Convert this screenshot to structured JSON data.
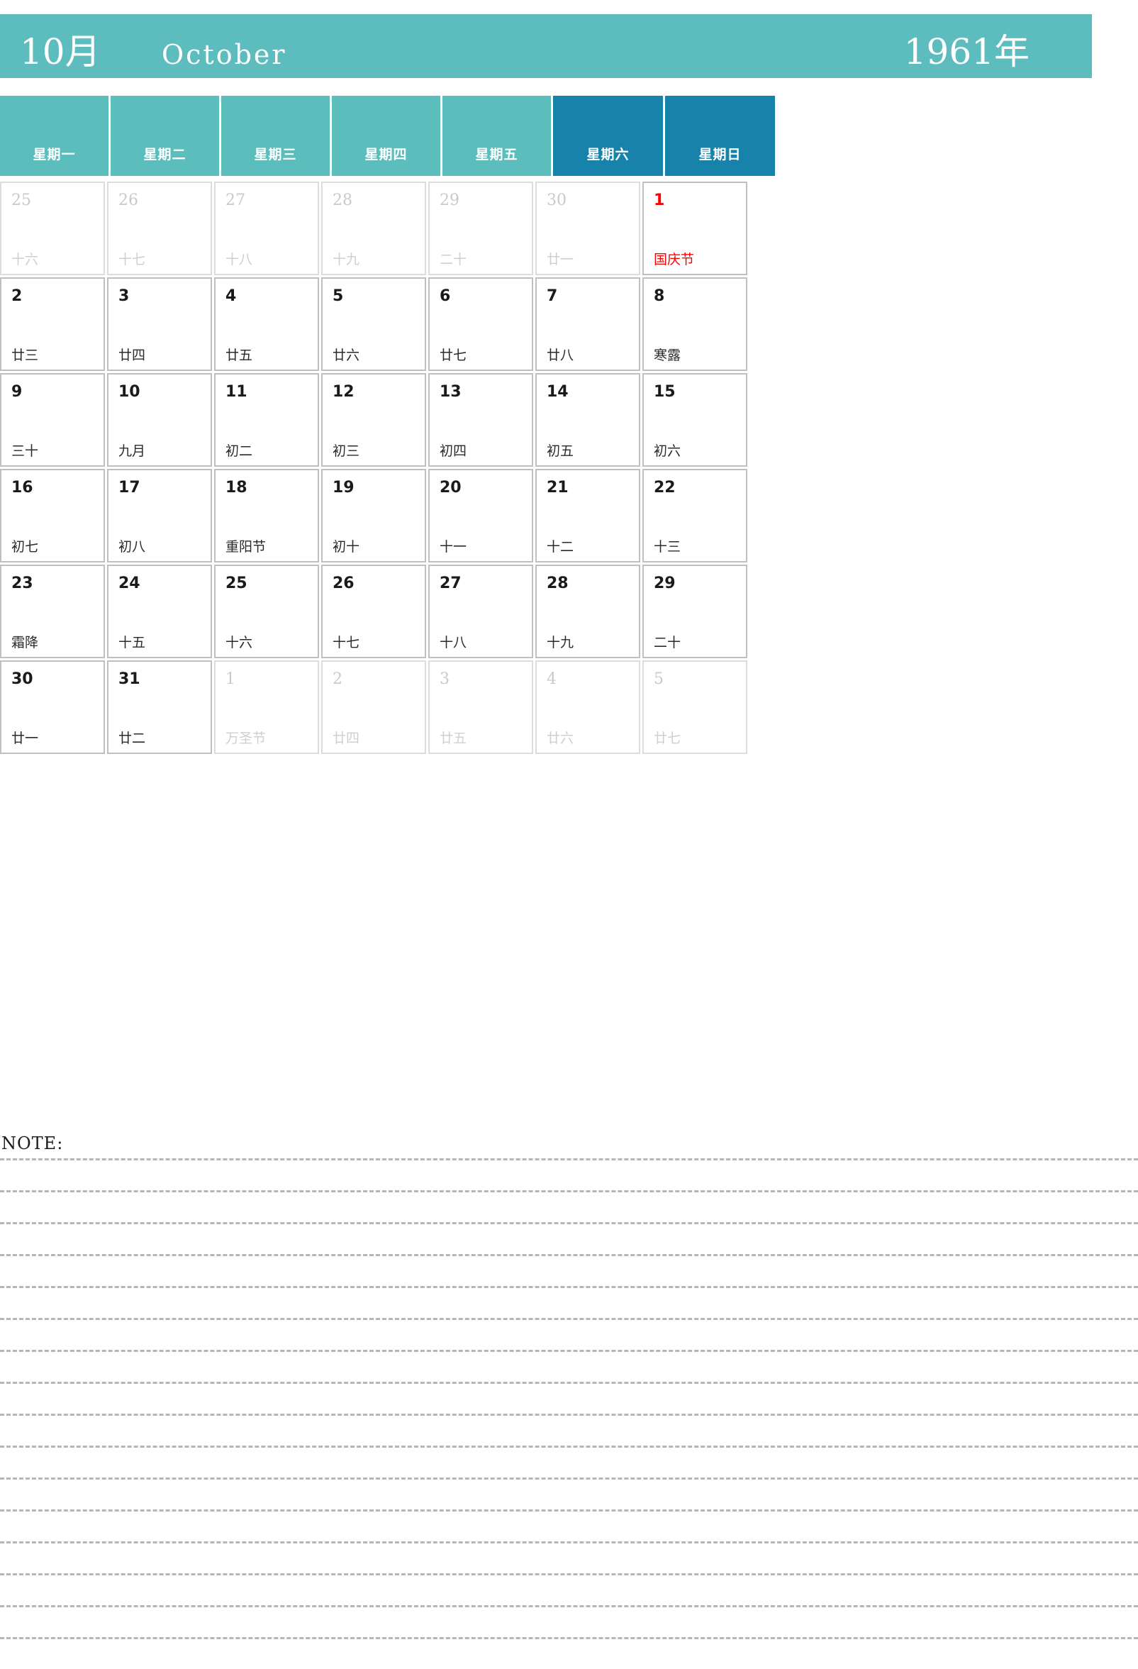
{
  "header": {
    "month_cn": "10月",
    "month_en": "October",
    "year_cn": "1961年",
    "bg_color": "#5dbcbd"
  },
  "weekdays": [
    {
      "label": "星期一",
      "weekend": false
    },
    {
      "label": "星期二",
      "weekend": false
    },
    {
      "label": "星期三",
      "weekend": false
    },
    {
      "label": "星期四",
      "weekend": false
    },
    {
      "label": "星期五",
      "weekend": false
    },
    {
      "label": "星期六",
      "weekend": true
    },
    {
      "label": "星期日",
      "weekend": true
    }
  ],
  "weekend_color": "#1783ab",
  "holiday_color": "#ff0000",
  "weeks": [
    [
      {
        "day": "25",
        "lunar": "十六",
        "out": true,
        "holiday": false
      },
      {
        "day": "26",
        "lunar": "十七",
        "out": true,
        "holiday": false
      },
      {
        "day": "27",
        "lunar": "十八",
        "out": true,
        "holiday": false
      },
      {
        "day": "28",
        "lunar": "十九",
        "out": true,
        "holiday": false
      },
      {
        "day": "29",
        "lunar": "二十",
        "out": true,
        "holiday": false
      },
      {
        "day": "30",
        "lunar": "廿一",
        "out": true,
        "holiday": false
      },
      {
        "day": "1",
        "lunar": "国庆节",
        "out": false,
        "holiday": true
      }
    ],
    [
      {
        "day": "2",
        "lunar": "廿三",
        "out": false,
        "holiday": false
      },
      {
        "day": "3",
        "lunar": "廿四",
        "out": false,
        "holiday": false
      },
      {
        "day": "4",
        "lunar": "廿五",
        "out": false,
        "holiday": false
      },
      {
        "day": "5",
        "lunar": "廿六",
        "out": false,
        "holiday": false
      },
      {
        "day": "6",
        "lunar": "廿七",
        "out": false,
        "holiday": false
      },
      {
        "day": "7",
        "lunar": "廿八",
        "out": false,
        "holiday": false
      },
      {
        "day": "8",
        "lunar": "寒露",
        "out": false,
        "holiday": false
      }
    ],
    [
      {
        "day": "9",
        "lunar": "三十",
        "out": false,
        "holiday": false
      },
      {
        "day": "10",
        "lunar": "九月",
        "out": false,
        "holiday": false
      },
      {
        "day": "11",
        "lunar": "初二",
        "out": false,
        "holiday": false
      },
      {
        "day": "12",
        "lunar": "初三",
        "out": false,
        "holiday": false
      },
      {
        "day": "13",
        "lunar": "初四",
        "out": false,
        "holiday": false
      },
      {
        "day": "14",
        "lunar": "初五",
        "out": false,
        "holiday": false
      },
      {
        "day": "15",
        "lunar": "初六",
        "out": false,
        "holiday": false
      }
    ],
    [
      {
        "day": "16",
        "lunar": "初七",
        "out": false,
        "holiday": false
      },
      {
        "day": "17",
        "lunar": "初八",
        "out": false,
        "holiday": false
      },
      {
        "day": "18",
        "lunar": "重阳节",
        "out": false,
        "holiday": false
      },
      {
        "day": "19",
        "lunar": "初十",
        "out": false,
        "holiday": false
      },
      {
        "day": "20",
        "lunar": "十一",
        "out": false,
        "holiday": false
      },
      {
        "day": "21",
        "lunar": "十二",
        "out": false,
        "holiday": false
      },
      {
        "day": "22",
        "lunar": "十三",
        "out": false,
        "holiday": false
      }
    ],
    [
      {
        "day": "23",
        "lunar": "霜降",
        "out": false,
        "holiday": false
      },
      {
        "day": "24",
        "lunar": "十五",
        "out": false,
        "holiday": false
      },
      {
        "day": "25",
        "lunar": "十六",
        "out": false,
        "holiday": false
      },
      {
        "day": "26",
        "lunar": "十七",
        "out": false,
        "holiday": false
      },
      {
        "day": "27",
        "lunar": "十八",
        "out": false,
        "holiday": false
      },
      {
        "day": "28",
        "lunar": "十九",
        "out": false,
        "holiday": false
      },
      {
        "day": "29",
        "lunar": "二十",
        "out": false,
        "holiday": false
      }
    ],
    [
      {
        "day": "30",
        "lunar": "廿一",
        "out": false,
        "holiday": false
      },
      {
        "day": "31",
        "lunar": "廿二",
        "out": false,
        "holiday": false
      },
      {
        "day": "1",
        "lunar": "万圣节",
        "out": true,
        "holiday": false
      },
      {
        "day": "2",
        "lunar": "廿四",
        "out": true,
        "holiday": false
      },
      {
        "day": "3",
        "lunar": "廿五",
        "out": true,
        "holiday": false
      },
      {
        "day": "4",
        "lunar": "廿六",
        "out": true,
        "holiday": false
      },
      {
        "day": "5",
        "lunar": "廿七",
        "out": true,
        "holiday": false
      }
    ]
  ],
  "note": {
    "label": "NOTE:",
    "line_count": 16
  }
}
